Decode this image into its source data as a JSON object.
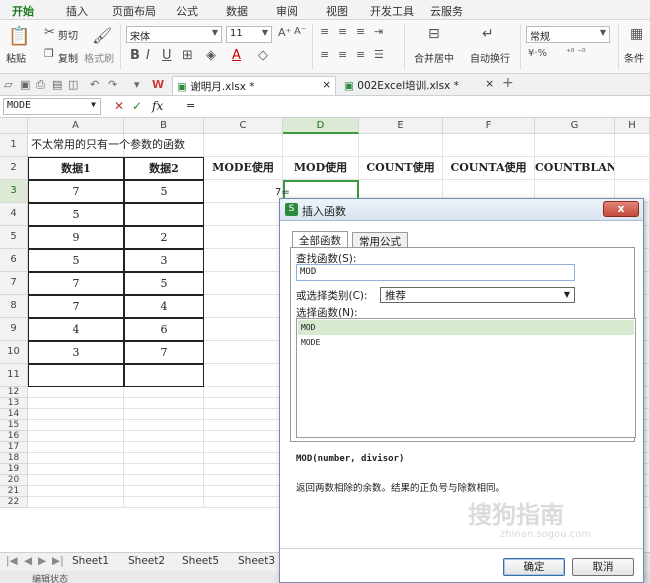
{
  "ribbon_tabs": [
    "开始",
    "插入",
    "页面布局",
    "公式",
    "数据",
    "审阅",
    "视图",
    "开发工具",
    "云服务"
  ],
  "ribbon": {
    "paste": "粘贴",
    "cut": "剪切",
    "copy": "复制",
    "format_painter": "格式刷",
    "font_name": "宋体",
    "font_size": "11",
    "merge_center": "合并居中",
    "wrap_text": "自动换行",
    "number_format": "常规",
    "conditional": "条件"
  },
  "documents": {
    "active": "谢明月.xlsx *",
    "other": "002Excel培训.xlsx *"
  },
  "formula_bar": {
    "name_box": "MODE",
    "fx": "fx",
    "formula": "="
  },
  "columns": [
    "A",
    "B",
    "C",
    "D",
    "E",
    "F",
    "G",
    "H"
  ],
  "selected_column": "D",
  "rows": [
    "1",
    "2",
    "3",
    "4",
    "5",
    "6",
    "7",
    "8",
    "9",
    "10",
    "11",
    "12",
    "13",
    "14",
    "15",
    "16",
    "17",
    "18",
    "19",
    "20",
    "21",
    "22"
  ],
  "selected_row": "3",
  "sheet": {
    "a1": "不太常用的只有一个参数的函数",
    "headers": {
      "a2": "数据1",
      "b2": "数据2",
      "c2": "MODE使用",
      "d2": "MOD使用",
      "e2": "COUNT使用",
      "f2": "COUNTA使用",
      "g2": "COUNTBLANK使用"
    },
    "data1": [
      "7",
      "5",
      "9",
      "5",
      "7",
      "7",
      "4",
      "3"
    ],
    "data2": [
      "5",
      "",
      "2",
      "3",
      "5",
      "4",
      "6",
      "7"
    ],
    "d3_editing": "7="
  },
  "sheet_tabs": [
    "Sheet1",
    "Sheet2",
    "Sheet5",
    "Sheet3"
  ],
  "status_text": "编辑状态",
  "dialog": {
    "title": "插入函数",
    "close": "x",
    "tab_all": "全部函数",
    "tab_common": "常用公式",
    "search_label": "查找函数(S):",
    "search_value": "MOD",
    "category_label": "或选择类别(C):",
    "category_value": "推荐",
    "select_label": "选择函数(N):",
    "functions": [
      "MOD",
      "MODE"
    ],
    "signature": "MOD(number, divisor)",
    "description": "返回两数相除的余数。结果的正负号与除数相同。",
    "ok": "确定",
    "cancel": "取消"
  },
  "watermark": "搜狗指南",
  "watermark_url": "zhinan.sogou.com"
}
